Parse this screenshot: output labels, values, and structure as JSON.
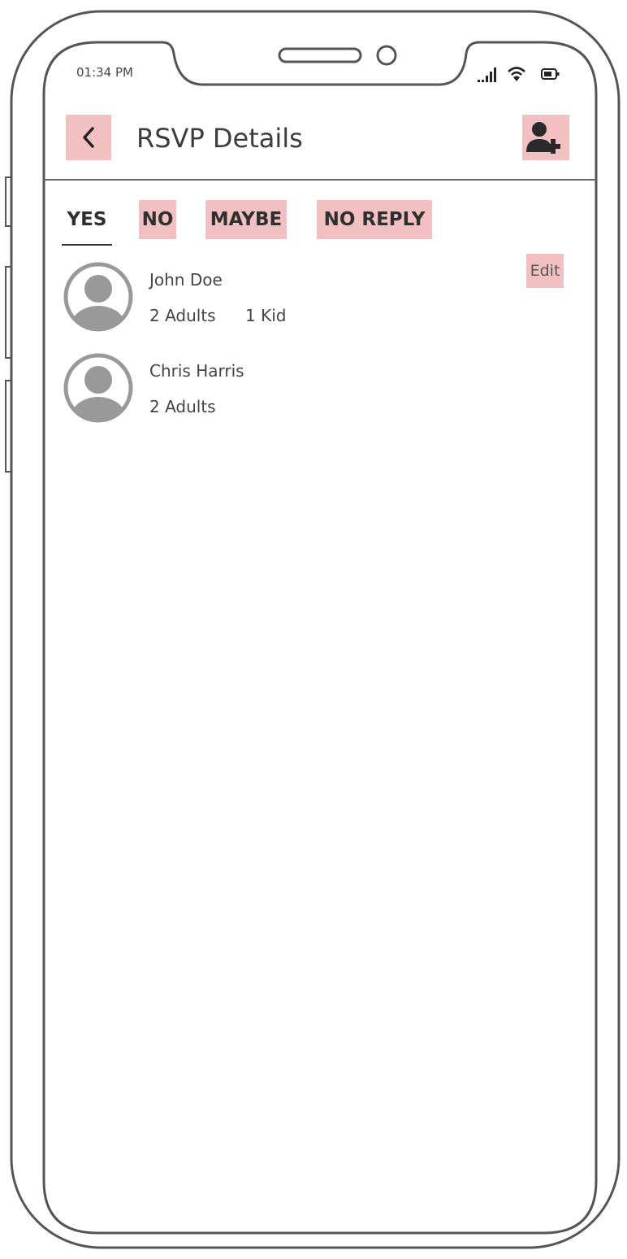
{
  "status_bar": {
    "time": "01:34 PM",
    "signal_icon": "signal-icon",
    "wifi_icon": "wifi-icon",
    "battery_icon": "battery-icon"
  },
  "header": {
    "title": "RSVP Details",
    "back_icon": "chevron-left-icon",
    "add_icon": "add-user-icon"
  },
  "tabs": [
    {
      "label": "YES",
      "active": true
    },
    {
      "label": "NO",
      "active": false
    },
    {
      "label": "MAYBE",
      "active": false
    },
    {
      "label": "NO REPLY",
      "active": false
    }
  ],
  "guests": [
    {
      "name": "John Doe",
      "adults": "2 Adults",
      "kids": "1 Kid",
      "edit_label": "Edit"
    },
    {
      "name": "Chris Harris",
      "adults": "2 Adults",
      "kids": ""
    }
  ],
  "colors": {
    "highlight": "#f2c0c0",
    "frame": "#555555",
    "avatar": "#999999"
  }
}
